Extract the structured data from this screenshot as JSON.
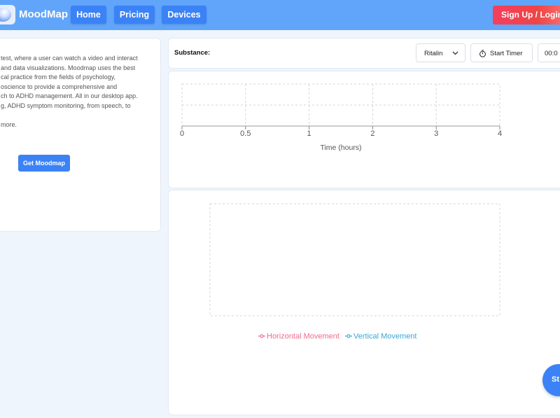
{
  "header": {
    "brand": "MoodMap",
    "nav": [
      "Home",
      "Pricing",
      "Devices"
    ],
    "signup_label": "Sign Up / Login"
  },
  "info": {
    "lines": [
      "test, where a user can watch a video and interact",
      "and data visualizations. Moodmap uses the best",
      "cal practice from the fields of psychology,",
      "oscience to provide a comprehensive and",
      "ch to ADHD management. All in our desktop app.",
      "g, ADHD symptom monitoring, from speech, to"
    ],
    "more": "more.",
    "cta": "Get Moodmap"
  },
  "toolbar": {
    "substance_label": "Substance:",
    "substance_value": "Ritalin",
    "timer_label": "Start Timer",
    "time_value": "00:0"
  },
  "colors": {
    "horizontal": "#f06a8c",
    "vertical": "#38a7d6"
  },
  "chart_data": [
    {
      "type": "line",
      "xlabel": "Time (hours)",
      "ylabel": "",
      "xlim": [
        0,
        4
      ],
      "x_ticks": [
        "0",
        "0.5",
        "1",
        "2",
        "3",
        "4"
      ],
      "series": [],
      "grid": true
    },
    {
      "type": "line",
      "xlabel": "",
      "ylabel": "",
      "series": [
        {
          "name": "Horizontal Movement",
          "values": []
        },
        {
          "name": "Vertical Movement",
          "values": []
        }
      ],
      "legend": "bottom",
      "grid": true
    }
  ],
  "fab_label": "St"
}
